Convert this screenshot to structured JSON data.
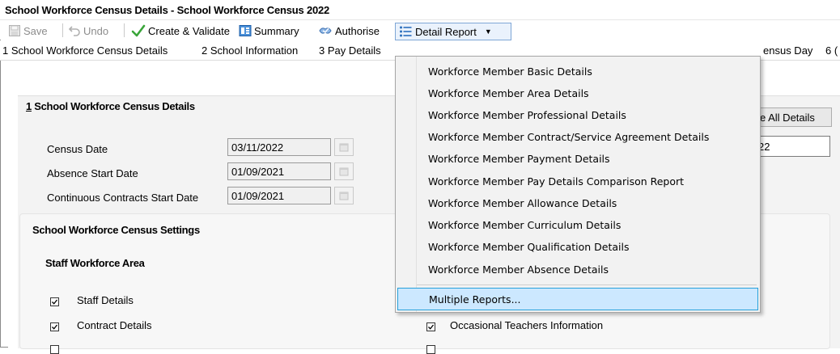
{
  "window": {
    "title": "School Workforce Census Details - School Workforce Census 2022"
  },
  "toolbar": {
    "save_label": "Save",
    "undo_label": "Undo",
    "create_validate_label": "Create & Validate",
    "summary_label": "Summary",
    "authorise_label": "Authorise",
    "detail_report_label": "Detail Report"
  },
  "nav": {
    "items": [
      "1 School Workforce Census Details",
      "2 School Information",
      "3 Pay Details",
      "ensus Day",
      "6 ("
    ]
  },
  "section": {
    "number": "1",
    "title": "School Workforce Census Details",
    "view_all_label": "e All Details",
    "year_value": "22"
  },
  "fields": [
    {
      "label": "Census Date",
      "value": "03/11/2022"
    },
    {
      "label": "Absence Start Date",
      "value": "01/09/2021"
    },
    {
      "label": "Continuous Contracts Start Date",
      "value": "01/09/2021"
    }
  ],
  "settings": {
    "title": "School Workforce Census Settings",
    "area_title": "Staff Workforce Area",
    "checkboxes_left": [
      {
        "label": "Staff Details",
        "checked": true
      },
      {
        "label": "Contract Details",
        "checked": true
      }
    ],
    "checkboxes_right": [
      {
        "label": "Occasional Teachers Information",
        "checked": true
      }
    ]
  },
  "menu": {
    "items": [
      "Workforce Member Basic Details",
      "Workforce Member Area Details",
      "Workforce Member Professional Details",
      "Workforce Member Contract/Service Agreement Details",
      "Workforce Member Payment Details",
      "Workforce Member Pay Details Comparison Report",
      "Workforce Member Allowance Details",
      "Workforce Member Curriculum Details",
      "Workforce Member Qualification Details",
      "Workforce Member Absence Details"
    ],
    "highlighted_item": "Multiple Reports..."
  },
  "colors": {
    "menu_highlight": "#cce8ff",
    "menu_highlight_border": "#26a0da",
    "check_green": "#3aa53a"
  }
}
